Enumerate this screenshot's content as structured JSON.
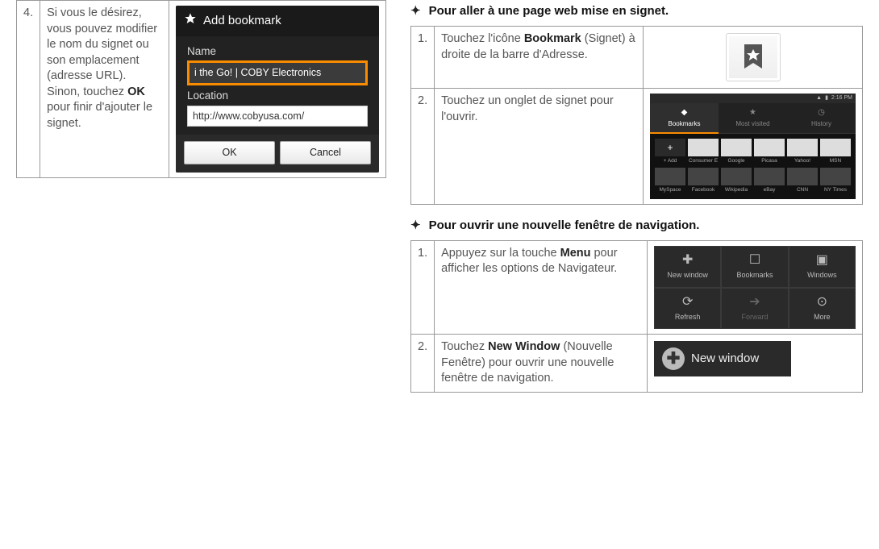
{
  "left": {
    "step4": {
      "num": "4.",
      "text_before_bold": "Si vous le désirez, vous pouvez modifier le nom du signet ou son emplacement (adresse URL). Sinon, touchez ",
      "bold": "OK",
      "text_after_bold": " pour finir d'ajouter le signet."
    },
    "dialog": {
      "title": "Add bookmark",
      "name_label": "Name",
      "name_value": "i the Go!  |  COBY Electronics",
      "location_label": "Location",
      "location_value": "http://www.cobyusa.com/",
      "ok": "OK",
      "cancel": "Cancel"
    }
  },
  "right": {
    "sectionA": {
      "title": "Pour aller à une page web mise en signet.",
      "step1": {
        "num": "1.",
        "t1": "Touchez l'icône ",
        "b1": "Bookmark",
        "t2": " (Signet) à droite de la barre d'Adresse."
      },
      "step2": {
        "num": "2.",
        "text": "Touchez un onglet de signet pour l'ouvrir."
      },
      "bookmarks_screen": {
        "status_time": "2:16 PM",
        "tabs": [
          "Bookmarks",
          "Most visited",
          "History"
        ],
        "items_row1": [
          "+ Add",
          "Consumer E",
          "Google",
          "Picasa",
          "Yahoo!",
          "MSN"
        ],
        "items_row2": [
          "MySpace",
          "Facebook",
          "Wikipedia",
          "eBay",
          "CNN",
          "NY Times"
        ]
      }
    },
    "sectionB": {
      "title": "Pour ouvrir une nouvelle fenêtre de navigation.",
      "step1": {
        "num": "1.",
        "t1": "Appuyez sur la touche ",
        "b1": "Menu",
        "t2": " pour afficher les options de Navigateur."
      },
      "step2": {
        "num": "2.",
        "t1": "Touchez ",
        "b1": "New Window",
        "t2": " (Nouvelle Fenêtre) pour ouvrir une nouvelle fenêtre de navigation."
      },
      "menu": {
        "items": [
          {
            "label": "New window",
            "icon": "plus-circle-icon"
          },
          {
            "label": "Bookmarks",
            "icon": "ribbon-icon"
          },
          {
            "label": "Windows",
            "icon": "windows-icon"
          },
          {
            "label": "Refresh",
            "icon": "refresh-icon"
          },
          {
            "label": "Forward",
            "icon": "arrow-right-icon",
            "dim": true
          },
          {
            "label": "More",
            "icon": "more-icon"
          }
        ]
      },
      "new_window_tile": {
        "label": "New window"
      }
    }
  }
}
